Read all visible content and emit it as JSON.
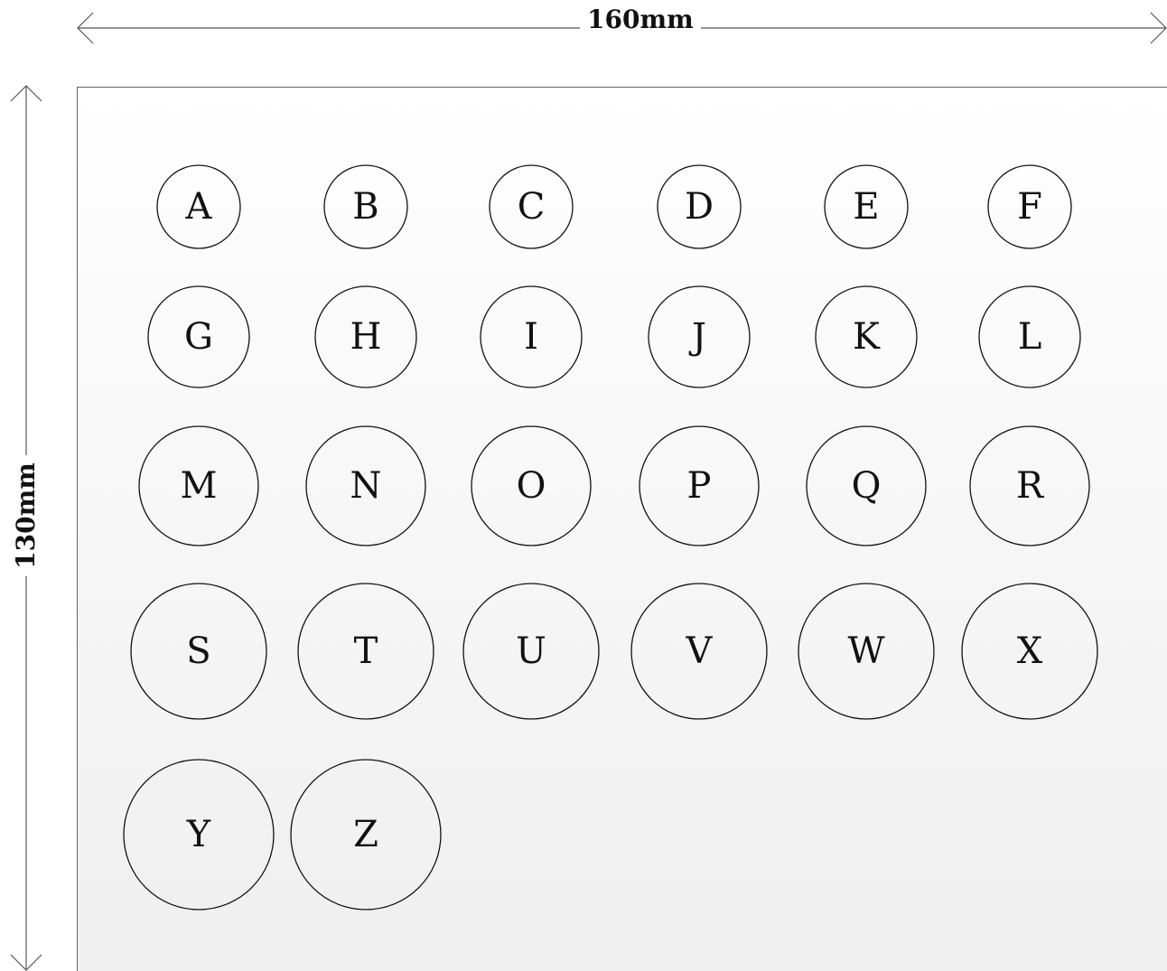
{
  "dimensions": {
    "width_label": "160mm",
    "height_label": "130mm"
  },
  "circles": [
    "A",
    "B",
    "C",
    "D",
    "E",
    "F",
    "G",
    "H",
    "I",
    "J",
    "K",
    "L",
    "M",
    "N",
    "O",
    "P",
    "Q",
    "R",
    "S",
    "T",
    "U",
    "V",
    "W",
    "X",
    "Y",
    "Z"
  ],
  "colors": {
    "stroke": "#111111",
    "panel_border": "#666666",
    "background": "#ffffff"
  }
}
